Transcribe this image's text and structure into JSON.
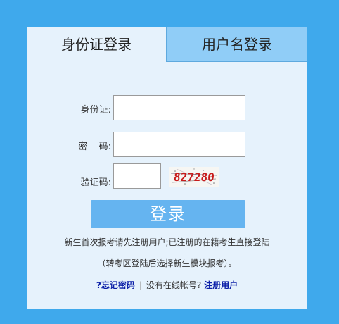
{
  "tabs": [
    {
      "label": "身份证登录",
      "active": true
    },
    {
      "label": "用户名登录",
      "active": false
    }
  ],
  "form": {
    "id_label": "身份证:",
    "password_label": "密    码:",
    "captcha_label": "验证码:",
    "id_value": "",
    "password_value": "",
    "captcha_value": "",
    "captcha_image_text": "827280"
  },
  "login_button": "登录",
  "notice_line1": "新生首次报考请先注册用户;已注册的在籍考生直接登陆",
  "notice_line2": "（转考区登陆后选择新生模块报考）。",
  "links": {
    "forgot_password": "?忘记密码",
    "separator": "|",
    "no_account": "没有在线帐号?",
    "register": "注册用户"
  },
  "colors": {
    "background": "#3fa9ec",
    "panel": "#e6f2fc",
    "inactive_tab": "#90cdf7",
    "button": "#65b4f0",
    "link": "#0b1fa8",
    "captcha_text": "#c81b1b"
  }
}
